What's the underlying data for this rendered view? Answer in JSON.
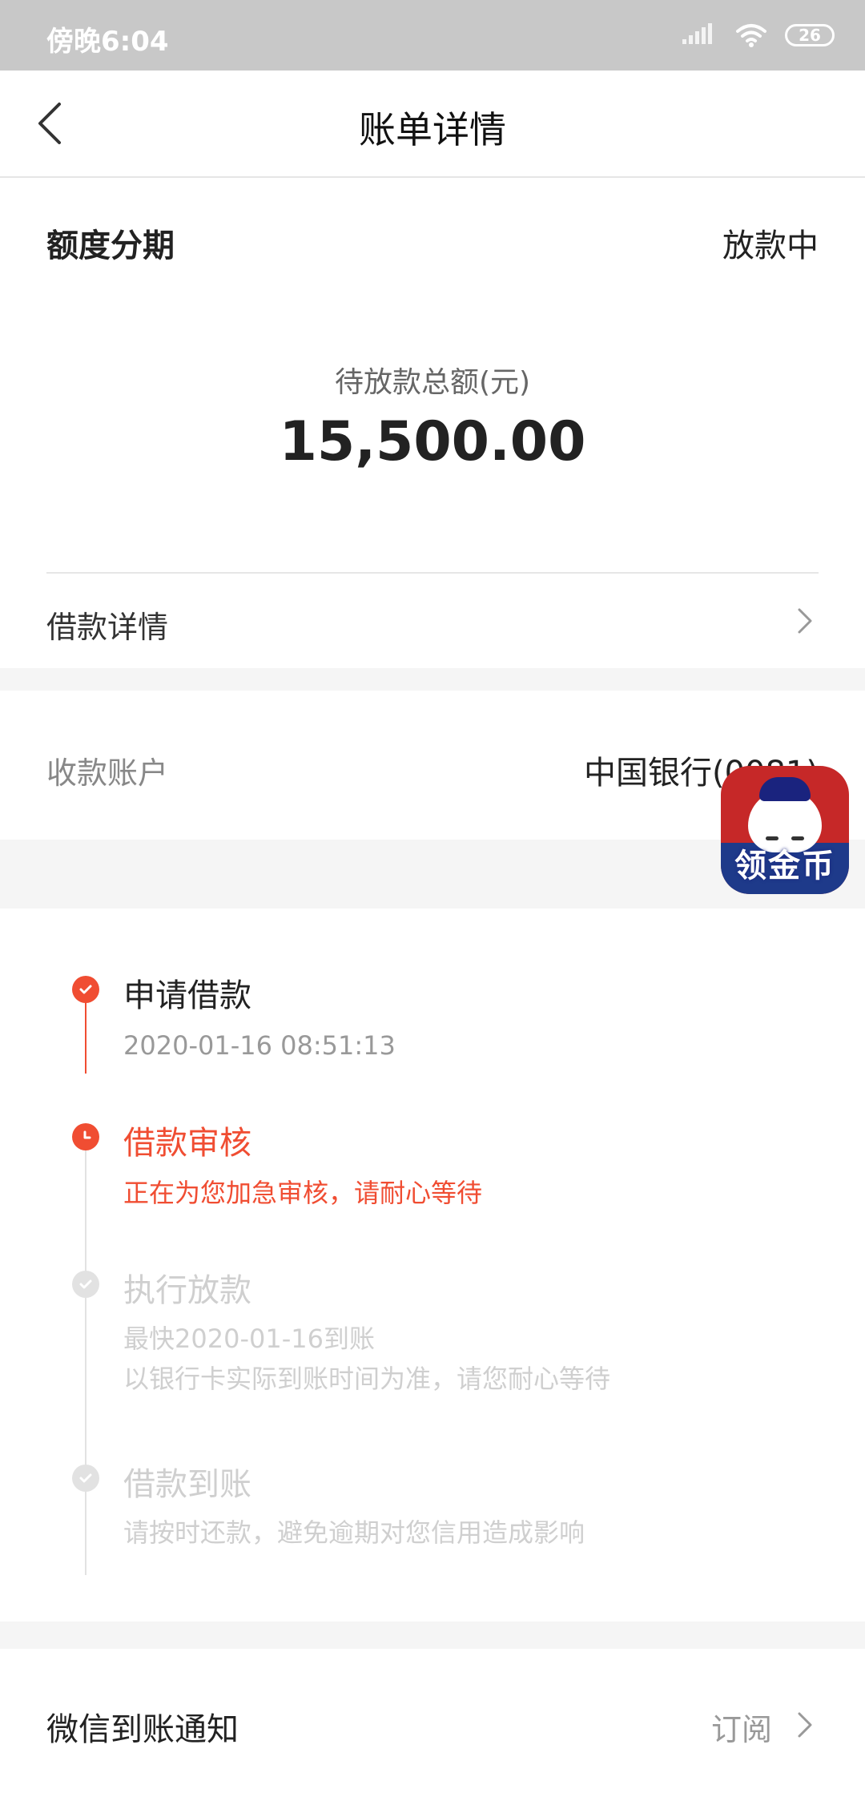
{
  "status_bar": {
    "time": "傍晚6:04",
    "battery": "26",
    "icons": [
      "signal-icon",
      "wifi-icon",
      "battery-icon"
    ]
  },
  "header": {
    "title": "账单详情",
    "back_icon": "chevron-left-icon"
  },
  "summary": {
    "type": "额度分期",
    "status": "放款中",
    "amount_label": "待放款总额(元)",
    "amount": "15,500.00",
    "detail_row_label": "借款详情"
  },
  "account": {
    "label": "收款账户",
    "value": "中国银行(0081)"
  },
  "floating_badge": {
    "text": "领金币"
  },
  "timeline": {
    "steps": [
      {
        "title": "申请借款",
        "sub": [
          "2020-01-16 08:51:13"
        ],
        "state": "done"
      },
      {
        "title": "借款审核",
        "sub": [
          "正在为您加急审核，请耐心等待"
        ],
        "state": "active"
      },
      {
        "title": "执行放款",
        "sub": [
          "最快2020-01-16到账",
          "以银行卡实际到账时间为准，请您耐心等待"
        ],
        "state": "pending"
      },
      {
        "title": "借款到账",
        "sub": [
          "请按时还款，避免逾期对您信用造成影响"
        ],
        "state": "pending"
      }
    ]
  },
  "notify": {
    "label": "微信到账通知",
    "action": "订阅"
  },
  "colors": {
    "accent": "#f04d32",
    "inactive": "#cfcfcf",
    "status_bar": "#c8c8c8"
  }
}
